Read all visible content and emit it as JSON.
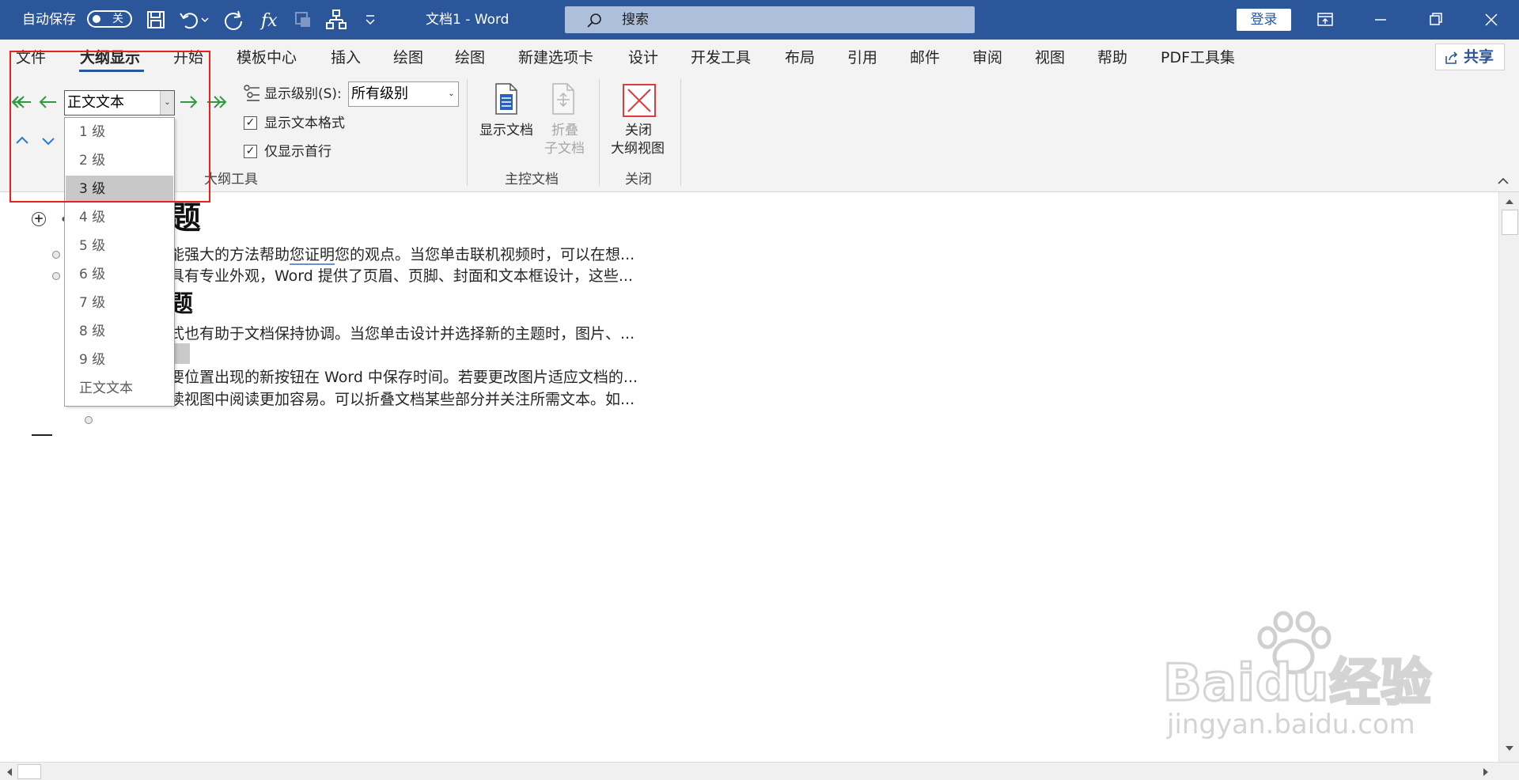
{
  "titlebar": {
    "autosave_label": "自动保存",
    "autosave_state": "关",
    "doc_title": "文档1  -  Word",
    "search_placeholder": "搜索",
    "login_label": "登录",
    "colors": {
      "bar": "#2b579a",
      "search_bg": "#aebfdb"
    }
  },
  "ribbon": {
    "tabs": [
      "文件",
      "大纲显示",
      "开始",
      "模板中心",
      "插入",
      "绘图",
      "绘图",
      "新建选项卡",
      "设计",
      "开发工具",
      "布局",
      "引用",
      "邮件",
      "审阅",
      "视图",
      "帮助",
      "PDF工具集"
    ],
    "active_tab": "大纲显示",
    "share_label": "共享",
    "outline_tools": {
      "level_value": "正文文本",
      "show_level_label": "显示级别(S):",
      "show_level_value": "所有级别",
      "show_text_format_label": "显示文本格式",
      "show_first_line_label": "仅显示首行",
      "group_name": "大纲工具"
    },
    "master_document": {
      "show_document_label": "显示文档",
      "collapse_subdocs_label_1": "折叠",
      "collapse_subdocs_label_2": "子文档",
      "group_name": "主控文档"
    },
    "close": {
      "close_outline_label_1": "关闭",
      "close_outline_label_2": "大纲视图",
      "group_name": "关闭"
    }
  },
  "level_dropdown": {
    "options": [
      "1 级",
      "2 级",
      "3 级",
      "4 级",
      "5 级",
      "6 级",
      "7 级",
      "8 级",
      "9 级",
      "正文文本"
    ],
    "highlighted": "3 级"
  },
  "document": {
    "heading1_fragment": "题",
    "heading2_fragment": "题",
    "line1_pre": "能强大的方法帮助",
    "line1_link": "您证明",
    "line1_post": "您的观点。当您单击联机视频时，可以在想...",
    "line2": "具有专业外观，Word 提供了页眉、页脚、封面和文本框设计，这些...",
    "line3": "式也有助于文档保持协调。当您单击设计并选择新的主题时，图片、...",
    "line4": "要位置出现的新按钮在 Word 中保存时间。若要更改图片适应文档的...",
    "line5": "读视图中阅读更加容易。可以折叠文档某些部分并关注所需文本。如..."
  },
  "watermark": {
    "brand": "Baidu经验",
    "url": "jingyan.baidu.com"
  }
}
